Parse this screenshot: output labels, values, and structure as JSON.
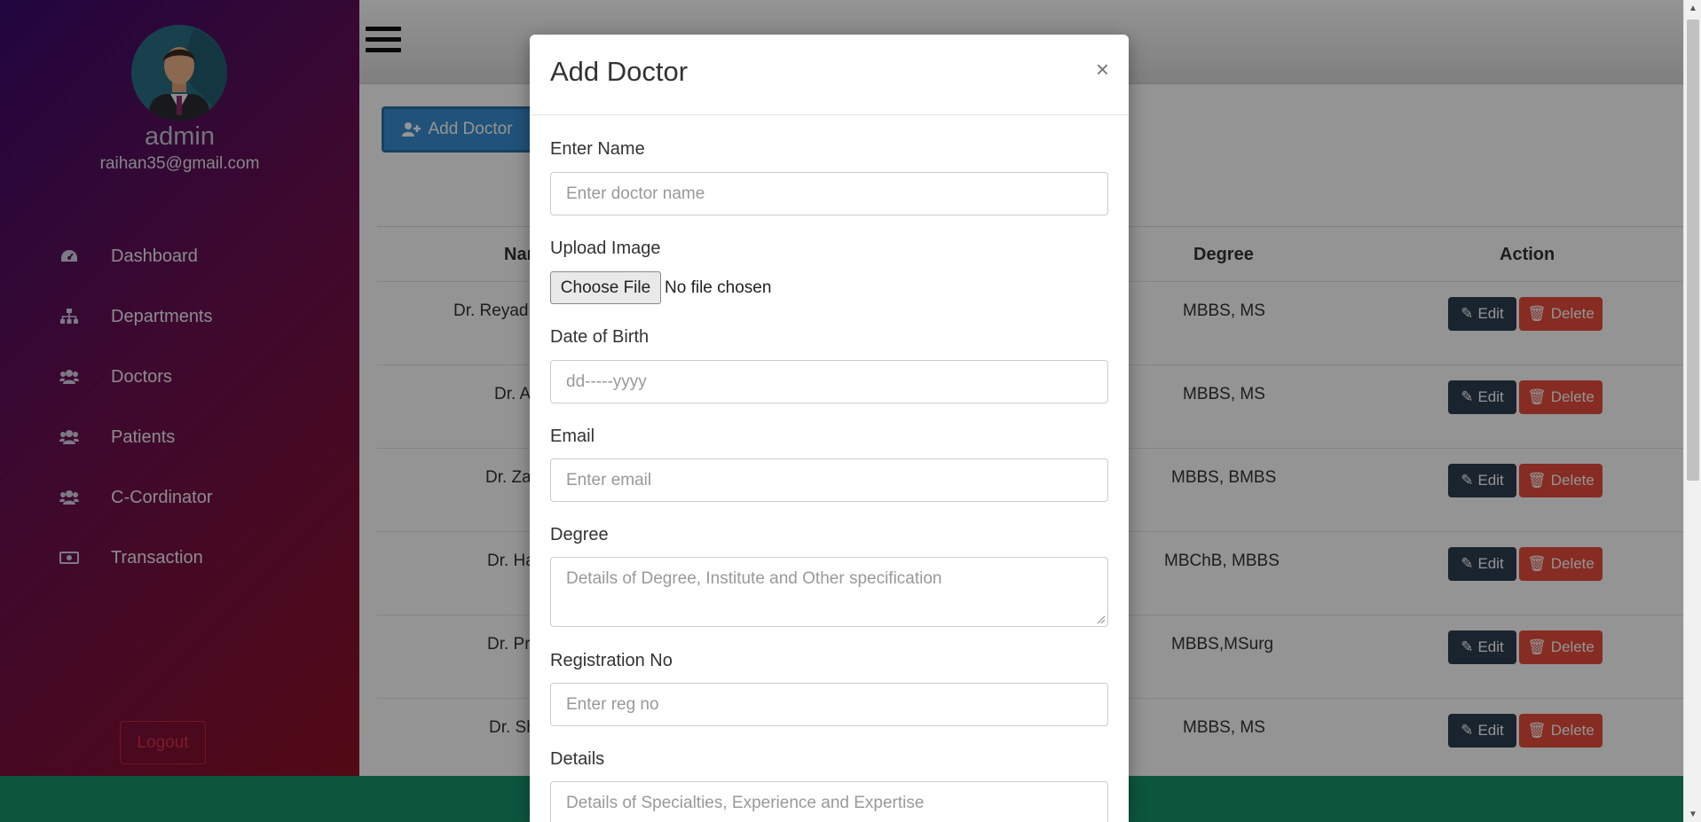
{
  "sidebar": {
    "username": "admin",
    "email": "raihan35@gmail.com",
    "nav": [
      {
        "label": "Dashboard",
        "icon": "dashboard-icon"
      },
      {
        "label": "Departments",
        "icon": "sitemap-icon"
      },
      {
        "label": "Doctors",
        "icon": "users-icon"
      },
      {
        "label": "Patients",
        "icon": "users-icon"
      },
      {
        "label": "C-Cordinator",
        "icon": "users-icon"
      },
      {
        "label": "Transaction",
        "icon": "money-icon"
      }
    ],
    "logout_label": "Logout"
  },
  "main": {
    "add_doctor_label": "Add Doctor",
    "table": {
      "headers": {
        "name": "Nar",
        "degree": "Degree",
        "action": "Action"
      },
      "rows": [
        {
          "name": "Dr. Reyad",
          "degree": "MBBS, MS"
        },
        {
          "name": "Dr. A",
          "degree": "MBBS, MS"
        },
        {
          "name": "Dr. Za",
          "degree": "MBBS, BMBS"
        },
        {
          "name": "Dr. Ha",
          "degree": "MBChB, MBBS"
        },
        {
          "name": "Dr. Pr",
          "degree": "MBBS,MSurg"
        },
        {
          "name": "Dr. Sh",
          "degree": "MBBS, MS"
        }
      ],
      "edit_label": "Edit",
      "delete_label": "Delete"
    }
  },
  "modal": {
    "title": "Add Doctor",
    "close_symbol": "×",
    "fields": {
      "name": {
        "label": "Enter Name",
        "placeholder": "Enter doctor name"
      },
      "image": {
        "label": "Upload Image",
        "button": "Choose File",
        "status": "No file chosen"
      },
      "dob": {
        "label": "Date of Birth",
        "placeholder": "dd-----yyyy"
      },
      "email": {
        "label": "Email",
        "placeholder": "Enter email"
      },
      "degree": {
        "label": "Degree",
        "placeholder": "Details of Degree, Institute and Other specification"
      },
      "reg": {
        "label": "Registration No",
        "placeholder": "Enter reg no"
      },
      "details": {
        "label": "Details",
        "placeholder": "Details of Specialties, Experience and Expertise"
      }
    }
  },
  "colors": {
    "sidebar_gradient_start": "#3a0b6e",
    "sidebar_gradient_end": "#8e1024",
    "primary_button": "#3a8dd0",
    "edit_button": "#2c3e50",
    "delete_button": "#e74c3c",
    "footer": "#17956b"
  }
}
